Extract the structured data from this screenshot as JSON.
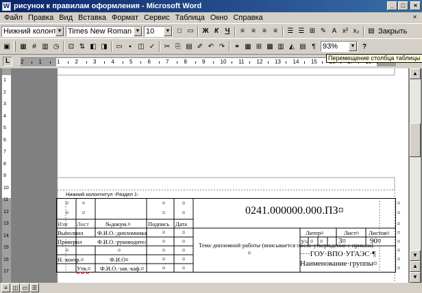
{
  "window": {
    "title": "рисунок к правилам оформления - Microsoft Word",
    "controls": [
      "_",
      "□",
      "×"
    ]
  },
  "menubar": {
    "items": [
      "Файл",
      "Правка",
      "Вид",
      "Вставка",
      "Формат",
      "Сервис",
      "Таблица",
      "Окно",
      "Справка"
    ],
    "close_doc": "×"
  },
  "toolbar": {
    "style_value": "Нижний колонтиту",
    "font_value": "Times New Roman",
    "size_value": "10",
    "bold": "Ж",
    "italic": "К",
    "underline": "Ч",
    "close_label": "Закрыть",
    "zoom_value": "93%",
    "help": "?"
  },
  "ruler": {
    "tab_selector": "L",
    "numbers": [
      "2",
      "1",
      "1",
      "2",
      "3",
      "4",
      "5",
      "6",
      "7",
      "8",
      "9",
      "10",
      "11",
      "12",
      "13",
      "14",
      "15",
      "16",
      "17",
      "18"
    ]
  },
  "vertical_ruler": {
    "numbers": [
      "1",
      "2",
      "3",
      "4",
      "5",
      "6",
      "7",
      "8",
      "9",
      "10",
      "11",
      "12",
      "13",
      "14",
      "15",
      "16",
      "17"
    ]
  },
  "tooltip": "Перемещение столбца таблицы",
  "footer_label": "Нижний колонтитул -Раздел 1-",
  "stamp": {
    "doc_code": "0241.000000.000.ПЗ¤",
    "header_izm": "Изм",
    "header_list": "Лист",
    "header_ndok": "№докум.¤",
    "header_podpis": "Подпись",
    "header_data": "Дата",
    "row_vypolnil": "Выполнил",
    "row_vypolnil_name": "Ф.И.О.·дипломника",
    "row_proveril": "Проверил",
    "row_proveril_name": "Ф.И.О.·руководителя",
    "row_nkontr": "Н.·контр.¤",
    "row_nkontr_name": "Ф.И.О¤",
    "row_utv": "Утв.¤",
    "row_utv_name": "Ф.И.О.·зав.·каф.¤",
    "topic": "Тема·дипломной·работы·(вписывается·после·утверждения·с·приказа)¤",
    "liter": "Литер¤",
    "list_label": "Лист¤",
    "listov_label": "Листов¤",
    "liter_value": "У¤",
    "list_value": "3¤",
    "listov_value": "90¤",
    "org_name": "····ГОУ·ВПО·УГАЭС·¶",
    "group_name": "Наименование·группы¤",
    "cell_mark": "¤"
  }
}
